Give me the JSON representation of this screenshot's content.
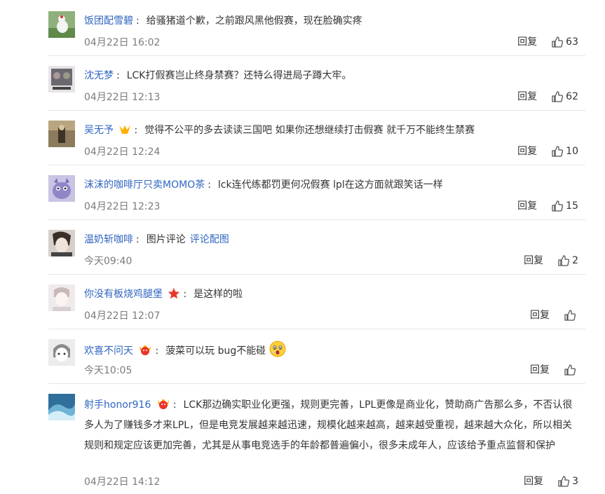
{
  "comments": [
    {
      "user": "饭团配雪碧",
      "badge": "",
      "text": "给骚猪道个歉，之前跟风黑他假赛，现在脸确实疼",
      "link": "",
      "time": "04月22日 16:02",
      "reply": "回复",
      "likes": "63",
      "avatar_color": "#7a9a68"
    },
    {
      "user": "沈无梦",
      "badge": "",
      "text": "LCK打假赛岂止终身禁赛？还特么得进局子蹲大牢。",
      "link": "",
      "time": "04月22日 12:13",
      "reply": "回复",
      "likes": "62",
      "avatar_color": "#6f6a70"
    },
    {
      "user": "吴无予",
      "badge": "vip-crown-icon",
      "text": "觉得不公平的多去读读三国吧 如果你还想继续打击假赛 就千万不能终生禁赛",
      "link": "",
      "time": "04月22日 12:24",
      "reply": "回复",
      "likes": "10",
      "avatar_color": "#7b6a4e"
    },
    {
      "user": "沫沫的咖啡厅只卖MOMO茶",
      "badge": "",
      "text": "lck连代练都罚更何况假赛 lpl在这方面就跟笑话一样",
      "link": "",
      "time": "04月22日 12:23",
      "reply": "回复",
      "likes": "15",
      "avatar_color": "#8f86c8"
    },
    {
      "user": "温奶斩咖啡",
      "badge": "",
      "text": "图片评论",
      "link": "评论配图",
      "time": "今天09:40",
      "reply": "回复",
      "likes": "2",
      "avatar_color": "#b9aea8"
    },
    {
      "user": "你没有板烧鸡腿堡",
      "badge": "red-star-icon",
      "text": "是这样的啦",
      "link": "",
      "time": "04月22日 12:07",
      "reply": "回复",
      "likes": "",
      "avatar_color": "#d8d2d4"
    },
    {
      "user": "欢喜不问天",
      "badge": "member-face-icon",
      "text": "菠菜可以玩 bug不能碰",
      "link": "",
      "time": "今天10:05",
      "reply": "回复",
      "likes": "",
      "avatar_color": "#e0e0e0",
      "emoji": "shocked-face-emoji"
    },
    {
      "user": "射手honor916",
      "badge": "member-face-icon",
      "text": "LCK那边确实职业化更强，规则更完善，LPL更像是商业化，赞助商广告那么多，不否认很多人为了赚钱多才来LPL，但是电竞发展越来越迅速，规模化越来越高，越来越受重视，越来越大众化，所以相关规则和规定应该更加完善，尤其是从事电竞选手的年龄都普遍偏小，很多未成年人，应该给予重点监督和保护",
      "link": "",
      "time": "04月22日 14:12",
      "reply": "回复",
      "likes": "3",
      "avatar_color": "#3d7fa6"
    }
  ]
}
